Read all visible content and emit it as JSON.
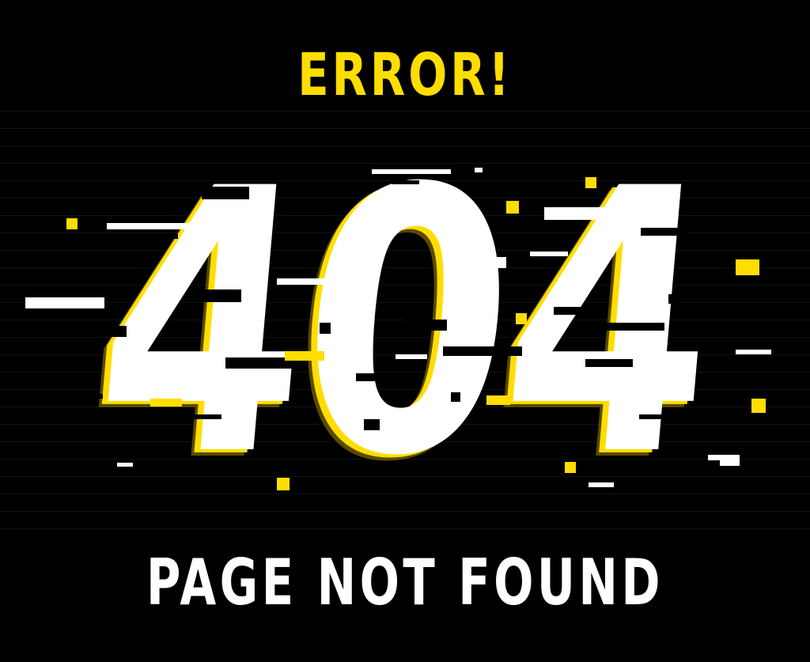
{
  "heading": "ERROR!",
  "code": "404",
  "message": "PAGE NOT FOUND",
  "colors": {
    "background": "#000000",
    "accent": "#ffdd00",
    "text": "#ffffff"
  }
}
